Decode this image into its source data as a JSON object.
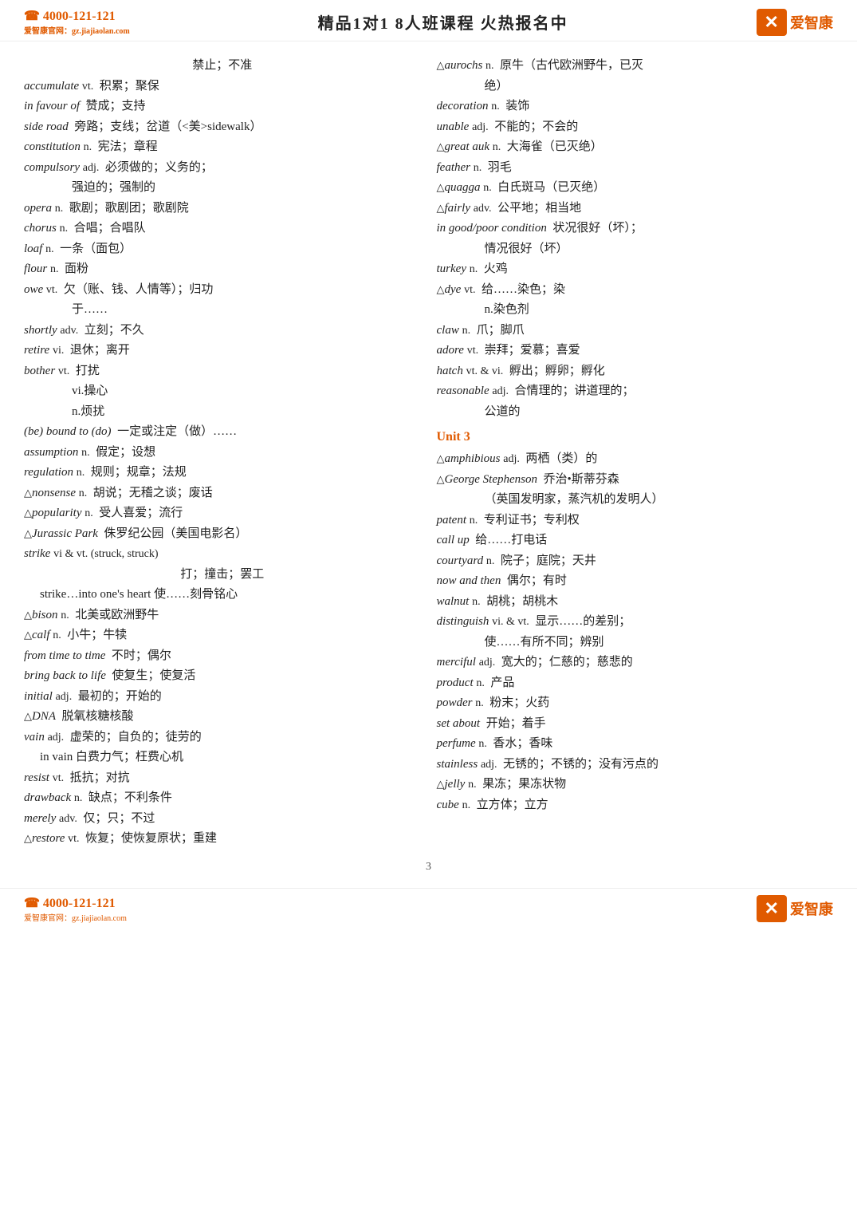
{
  "header": {
    "phone": "☎ 4000-121-121",
    "phone_sub": "爱智康官网：gz.jiajiaolan.com",
    "title": "精品1对1  8人班课程 火热报名中",
    "logo_icon": "✕",
    "logo_name": "爱智康"
  },
  "footer": {
    "phone": "☎ 4000-121-121",
    "phone_sub": "爱智康官网：gz.jiajiaolan.com",
    "logo_icon": "✕",
    "logo_name": "爱智康"
  },
  "page_number": "3",
  "left_column": [
    {
      "type": "center",
      "text": "禁止；不准"
    },
    {
      "word": "accumulate",
      "pos": "vt.",
      "zh": "积累；聚保"
    },
    {
      "word": "in favour of",
      "pos": "",
      "zh": "赞成；支持"
    },
    {
      "word": "side road",
      "pos": "",
      "zh": "旁路；支线；岔道（<美>sidewalk）"
    },
    {
      "word": "constitution",
      "pos": "n.",
      "zh": "宪法；章程"
    },
    {
      "word": "compulsory",
      "pos": "adj.",
      "zh": "必须做的；义务的；"
    },
    {
      "type": "indent",
      "text": "强迫的；强制的"
    },
    {
      "word": "opera",
      "pos": "n.",
      "zh": "歌剧；歌剧团；歌剧院"
    },
    {
      "word": "chorus",
      "pos": "n.",
      "zh": "合唱；合唱队"
    },
    {
      "word": "loaf",
      "pos": "n.",
      "zh": "一条（面包）"
    },
    {
      "word": "flour",
      "pos": "n.",
      "zh": "面粉"
    },
    {
      "word": "owe",
      "pos": "vt.",
      "zh": "欠（账、钱、人情等）；归功"
    },
    {
      "type": "indent",
      "text": "于……"
    },
    {
      "word": "shortly",
      "pos": "adv.",
      "zh": "立刻；不久"
    },
    {
      "word": "retire",
      "pos": "vi.",
      "zh": "退休；离开"
    },
    {
      "word": "bother",
      "pos": "vt.",
      "zh": "打扰"
    },
    {
      "type": "indent",
      "text": "vi.操心"
    },
    {
      "type": "indent",
      "text": "n.烦扰"
    },
    {
      "word": "(be) bound to (do)",
      "pos": "",
      "zh": "一定或注定（做）……"
    },
    {
      "word": "assumption",
      "pos": "n.",
      "zh": "假定；设想"
    },
    {
      "word": "regulation",
      "pos": "n.",
      "zh": "规则；规章；法规"
    },
    {
      "triangle": true,
      "word": "nonsense",
      "pos": "n.",
      "zh": "胡说；无稽之谈；废话"
    },
    {
      "triangle": true,
      "word": "popularity",
      "pos": "n.",
      "zh": "受人喜爱；流行"
    },
    {
      "triangle": true,
      "word": "Jurassic Park",
      "pos": "",
      "zh": "侏罗纪公园（美国电影名）"
    },
    {
      "word": "strike",
      "pos": "vi & vt. (struck, struck)"
    },
    {
      "type": "center",
      "text": "打；撞击；罢工"
    },
    {
      "type": "indent-sm",
      "word": "strike…into one's heart",
      "pos": "",
      "zh": "使……刻骨铭心"
    },
    {
      "triangle": true,
      "word": "bison",
      "pos": "n.",
      "zh": "北美或欧洲野牛"
    },
    {
      "triangle": true,
      "word": "calf",
      "pos": "n.",
      "zh": "小牛；牛犊"
    },
    {
      "word": "from time to time",
      "pos": "",
      "zh": "不时；偶尔"
    },
    {
      "word": "bring back to life",
      "pos": "",
      "zh": "使复生；使复活"
    },
    {
      "word": "initial",
      "pos": "adj.",
      "zh": "最初的；开始的"
    },
    {
      "triangle": true,
      "word": "DNA",
      "pos": "",
      "zh": "脱氧核糖核酸"
    },
    {
      "word": "vain",
      "pos": "adj.",
      "zh": "虚荣的；自负的；徒劳的"
    },
    {
      "type": "indent-sm",
      "word": "in vain",
      "pos": "",
      "zh": "白费力气；枉费心机"
    },
    {
      "word": "resist",
      "pos": "vt.",
      "zh": "抵抗；对抗"
    },
    {
      "word": "drawback",
      "pos": "n.",
      "zh": "缺点；不利条件"
    },
    {
      "word": "merely",
      "pos": "adv.",
      "zh": "仅；只；不过"
    },
    {
      "triangle": true,
      "word": "restore",
      "pos": "vt.",
      "zh": "恢复；使恢复原状；重建"
    }
  ],
  "right_column": [
    {
      "triangle": true,
      "word": "aurochs",
      "pos": "n.",
      "zh": "原牛（古代欧洲野牛，已灭"
    },
    {
      "type": "indent",
      "text": "绝）"
    },
    {
      "word": "decoration",
      "pos": "n.",
      "zh": "装饰"
    },
    {
      "word": "unable",
      "pos": "adj.",
      "zh": "不能的；不会的"
    },
    {
      "triangle": true,
      "word": "great auk",
      "pos": "n.",
      "zh": "大海雀（已灭绝）"
    },
    {
      "word": "feather",
      "pos": "n.",
      "zh": "羽毛"
    },
    {
      "triangle": true,
      "word": "quagga",
      "pos": "n.",
      "zh": "白氏斑马（已灭绝）"
    },
    {
      "triangle": true,
      "word": "fairly",
      "pos": "adv.",
      "zh": "公平地；相当地"
    },
    {
      "word": "in good/poor condition",
      "pos": "",
      "zh": "状况很好（坏）；"
    },
    {
      "type": "indent",
      "text": "情况很好（坏）"
    },
    {
      "word": "turkey",
      "pos": "n.",
      "zh": "火鸡"
    },
    {
      "triangle": true,
      "word": "dye",
      "pos": "vt.",
      "zh": "给……染色；染"
    },
    {
      "type": "indent",
      "text": "n.染色剂"
    },
    {
      "word": "claw",
      "pos": "n.",
      "zh": "爪；脚爪"
    },
    {
      "word": "adore",
      "pos": "vt.",
      "zh": "崇拜；爱慕；喜爱"
    },
    {
      "word": "hatch",
      "pos": "vt. & vi.",
      "zh": "孵出；孵卵；孵化"
    },
    {
      "word": "reasonable",
      "pos": "adj.",
      "zh": "合情理的；讲道理的；"
    },
    {
      "type": "indent",
      "text": "公道的"
    },
    {
      "type": "unit",
      "text": "Unit 3"
    },
    {
      "triangle": true,
      "word": "amphibious",
      "pos": "adj.",
      "zh": "两栖（类）的"
    },
    {
      "triangle": true,
      "word": "George Stephenson",
      "pos": "",
      "zh": "乔治•斯蒂芬森"
    },
    {
      "type": "indent",
      "text": "（英国发明家，蒸汽机的发明人）"
    },
    {
      "word": "patent",
      "pos": "n.",
      "zh": "专利证书；专利权"
    },
    {
      "word": "call up",
      "pos": "",
      "zh": "给……打电话"
    },
    {
      "word": "courtyard",
      "pos": "n.",
      "zh": "院子；庭院；天井"
    },
    {
      "word": "now and then",
      "pos": "",
      "zh": "偶尔；有时"
    },
    {
      "word": "walnut",
      "pos": "n.",
      "zh": "胡桃；胡桃木"
    },
    {
      "word": "distinguish",
      "pos": "vi. & vt.",
      "zh": "显示……的差别；"
    },
    {
      "type": "indent",
      "text": "使……有所不同；辨别"
    },
    {
      "word": "merciful",
      "pos": "adj.",
      "zh": "宽大的；仁慈的；慈悲的"
    },
    {
      "word": "product",
      "pos": "n.",
      "zh": "产品"
    },
    {
      "word": "powder",
      "pos": "n.",
      "zh": "粉末；火药"
    },
    {
      "word": "set about",
      "pos": "",
      "zh": "开始；着手"
    },
    {
      "word": "perfume",
      "pos": "n.",
      "zh": "香水；香味"
    },
    {
      "word": "stainless",
      "pos": "adj.",
      "zh": "无锈的；不锈的；没有污点的"
    },
    {
      "triangle": true,
      "word": "jelly",
      "pos": "n.",
      "zh": "果冻；果冻状物"
    },
    {
      "word": "cube",
      "pos": "n.",
      "zh": "立方体；立方"
    }
  ]
}
